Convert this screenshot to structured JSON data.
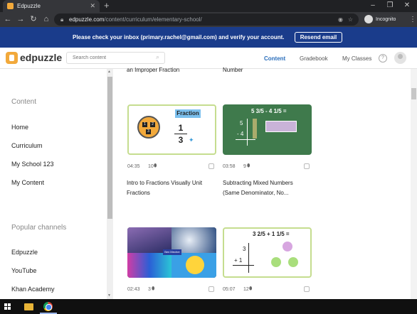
{
  "browser": {
    "tab_title": "Edpuzzle",
    "tab_close": "✕",
    "new_tab": "+",
    "url_host": "edpuzzle.com",
    "url_path": "/content/curriculum/elementary-school/",
    "incognito_label": "Incognito"
  },
  "banner": {
    "message": "Please check your inbox (primary.rachel@gmail.com) and verify your account.",
    "resend_label": "Resend email"
  },
  "header": {
    "brand": "edpuzzle",
    "search_placeholder": "Search content",
    "nav": [
      "Content",
      "Gradebook",
      "My Classes"
    ],
    "help": "?"
  },
  "sidebar": {
    "section_content": "Content",
    "items": [
      "Home",
      "Curriculum",
      "My School 123",
      "My Content"
    ],
    "section_channels": "Popular channels",
    "channels": [
      "Edpuzzle",
      "YouTube",
      "Khan Academy"
    ]
  },
  "main": {
    "partial_titles": [
      "an Improper Fraction",
      "Number"
    ],
    "cards": [
      {
        "duration": "04:35",
        "questions": "10",
        "title_line1": "Intro to Fractions Visually Unit",
        "title_line2": "Fractions",
        "thumb_label": "Fraction",
        "thumb_num": "1",
        "thumb_den": "3"
      },
      {
        "duration": "03:58",
        "questions": "9",
        "title_line1": "Subtracting Mixed Numbers",
        "title_line2": "(Same Denominator, No...",
        "thumb_expr": "5 3/5 - 4 1/5 ="
      },
      {
        "duration": "02:43",
        "questions": "3",
        "thumb_label": "Ben Mecher"
      },
      {
        "duration": "05:07",
        "questions": "12",
        "thumb_expr": "3 2/5 + 1 1/5 ="
      }
    ]
  },
  "colors": {
    "banner_bg": "#1a3c8b",
    "accent_blue": "#2a6ebb",
    "brand_orange": "#f2a93b",
    "card_border_green": "#c5dd8f",
    "chalkboard": "#3f7a4c"
  },
  "icons": [
    "edpuzzle-logo-icon",
    "search-icon",
    "help-icon",
    "avatar-icon",
    "question-marker-icon",
    "lock-icon",
    "star-icon",
    "kebab-icon"
  ]
}
